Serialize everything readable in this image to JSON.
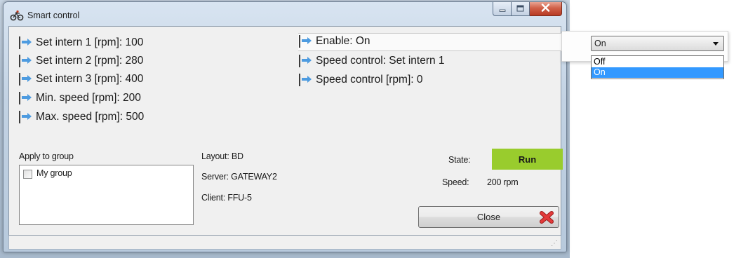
{
  "window": {
    "title": "Smart control",
    "app_icon": "bicycle-icon",
    "caption_buttons": [
      "minimize-icon",
      "maximize-icon",
      "close-icon"
    ]
  },
  "parameters": {
    "left": [
      {
        "label": "Set intern 1 [rpm]: 100"
      },
      {
        "label": "Set intern 2 [rpm]: 280"
      },
      {
        "label": "Set intern 3 [rpm]: 400"
      },
      {
        "label": "Min. speed [rpm]: 200"
      },
      {
        "label": "Max. speed [rpm]: 500"
      }
    ],
    "right": [
      {
        "label": "Enable: On",
        "selected": true
      },
      {
        "label": "Speed control: Set intern 1"
      },
      {
        "label": "Speed control [rpm]: 0"
      }
    ]
  },
  "group": {
    "label": "Apply to group",
    "items": [
      {
        "label": "My group",
        "checked": false
      }
    ]
  },
  "info": {
    "layout": "Layout: BD",
    "server": "Server: GATEWAY2",
    "client": "Client: FFU-5"
  },
  "state": {
    "label": "State:",
    "value": "Run",
    "color": "#99cc2d"
  },
  "speed": {
    "label": "Speed:",
    "value": "200 rpm"
  },
  "close_button": {
    "label": "Close",
    "icon": "red-x-icon"
  },
  "dropdown": {
    "selected": "On",
    "options": [
      "Off",
      "On"
    ],
    "highlighted_index": 1,
    "highlight_color": "#3399ff"
  },
  "colors": {
    "arrow": "#4d9be0"
  }
}
